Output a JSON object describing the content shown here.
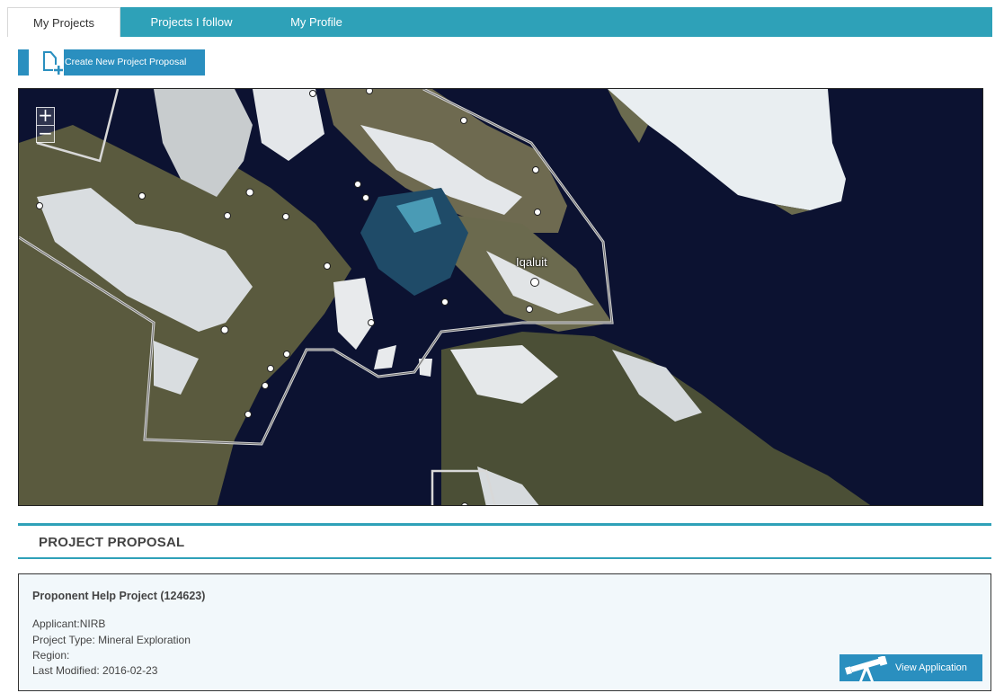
{
  "tabs": [
    {
      "label": "My Projects",
      "active": true
    },
    {
      "label": "Projects I follow",
      "active": false
    },
    {
      "label": "My Profile",
      "active": false
    }
  ],
  "toolbar": {
    "create_label": "Create New Project Proposal",
    "create_icon": "new-document-icon"
  },
  "map": {
    "zoom_in": "+",
    "zoom_out": "−",
    "city_label": "Iqaluit"
  },
  "section": {
    "title": "PROJECT PROPOSAL"
  },
  "proposal": {
    "title": "Proponent Help Project (124623)",
    "applicant": "Applicant:NIRB",
    "project_type": "Project Type: Mineral Exploration",
    "region": "Region:",
    "last_modified": "Last Modified: 2016-02-23",
    "view_label": "View Application",
    "view_icon": "telescope-icon"
  },
  "colors": {
    "accent": "#2ea1b8",
    "button": "#2a8fbf",
    "card_bg": "#f2f8fb"
  }
}
